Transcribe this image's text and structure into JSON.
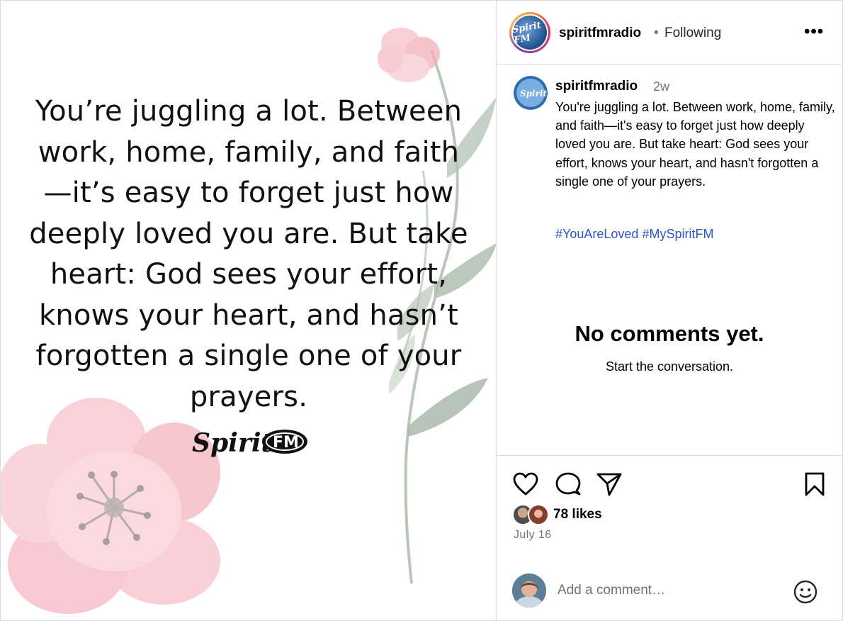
{
  "post": {
    "quote": "You’re juggling a lot. Between work, home, family, and faith—it’s easy to forget just how deeply loved you are. But take heart: God sees your effort, knows your heart, and hasn’t forgotten a single one of your prayers.",
    "brand_logo_text": "Spirit FM"
  },
  "header": {
    "avatar_text": "Spirit FM",
    "username": "spiritfmradio",
    "separator": "•",
    "follow_status": "Following",
    "more": "•••"
  },
  "caption": {
    "username": "spiritfmradio",
    "time": "2w",
    "text": "You're juggling a lot. Between work, home, family, and faith—it's easy to forget just how deeply loved you are. But take heart: God sees your effort, knows your heart, and hasn't forgotten a single one of your prayers.",
    "hashtags": "#YouAreLoved #MySpiritFM"
  },
  "comments": {
    "empty_title": "No comments yet.",
    "empty_subtitle": "Start the conversation."
  },
  "engagement": {
    "likes": "78 likes",
    "date": "July 16"
  },
  "composer": {
    "placeholder": "Add a comment…"
  },
  "icons": [
    "heart-icon",
    "comment-icon",
    "share-icon",
    "bookmark-icon",
    "emoji-icon",
    "more-icon"
  ],
  "colors": {
    "hashtag": "#2b55d1",
    "muted": "#737373",
    "border": "#dbdbdb",
    "flower": "#f4b7c0",
    "leaf": "#9fb3a2"
  }
}
